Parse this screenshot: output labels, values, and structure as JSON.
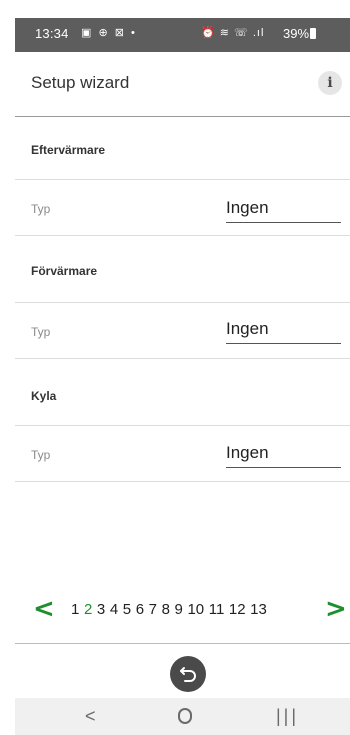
{
  "status_bar": {
    "time": "13:34",
    "left_icons": "▣ ⊕ ⊠ •",
    "right_icons": "⏰ ≋ ☏ .ıl",
    "battery": "39%"
  },
  "header": {
    "title": "Setup wizard",
    "info_label": "i"
  },
  "sections": [
    {
      "title": "Eftervärmare",
      "type_label": "Typ",
      "value": "Ingen"
    },
    {
      "title": "Förvärmare",
      "type_label": "Typ",
      "value": "Ingen"
    },
    {
      "title": "Kyla",
      "type_label": "Typ",
      "value": "Ingen"
    }
  ],
  "pager": {
    "prev": "<",
    "next": ">",
    "pages": [
      "1",
      "2",
      "3",
      "4",
      "5",
      "6",
      "7",
      "8",
      "9",
      "10",
      "11",
      "12",
      "13"
    ],
    "current_page": "2"
  },
  "colors": {
    "accent_green": "#1f8f2e",
    "status_bar": "#5d5d5d"
  },
  "icons": {
    "back_button": "undo-arrow-icon",
    "nav_back": "chevron-left-icon",
    "nav_home": "home-circle-icon",
    "nav_recents": "recents-icon"
  },
  "navbar": {
    "back": "<",
    "recents": "|||"
  }
}
